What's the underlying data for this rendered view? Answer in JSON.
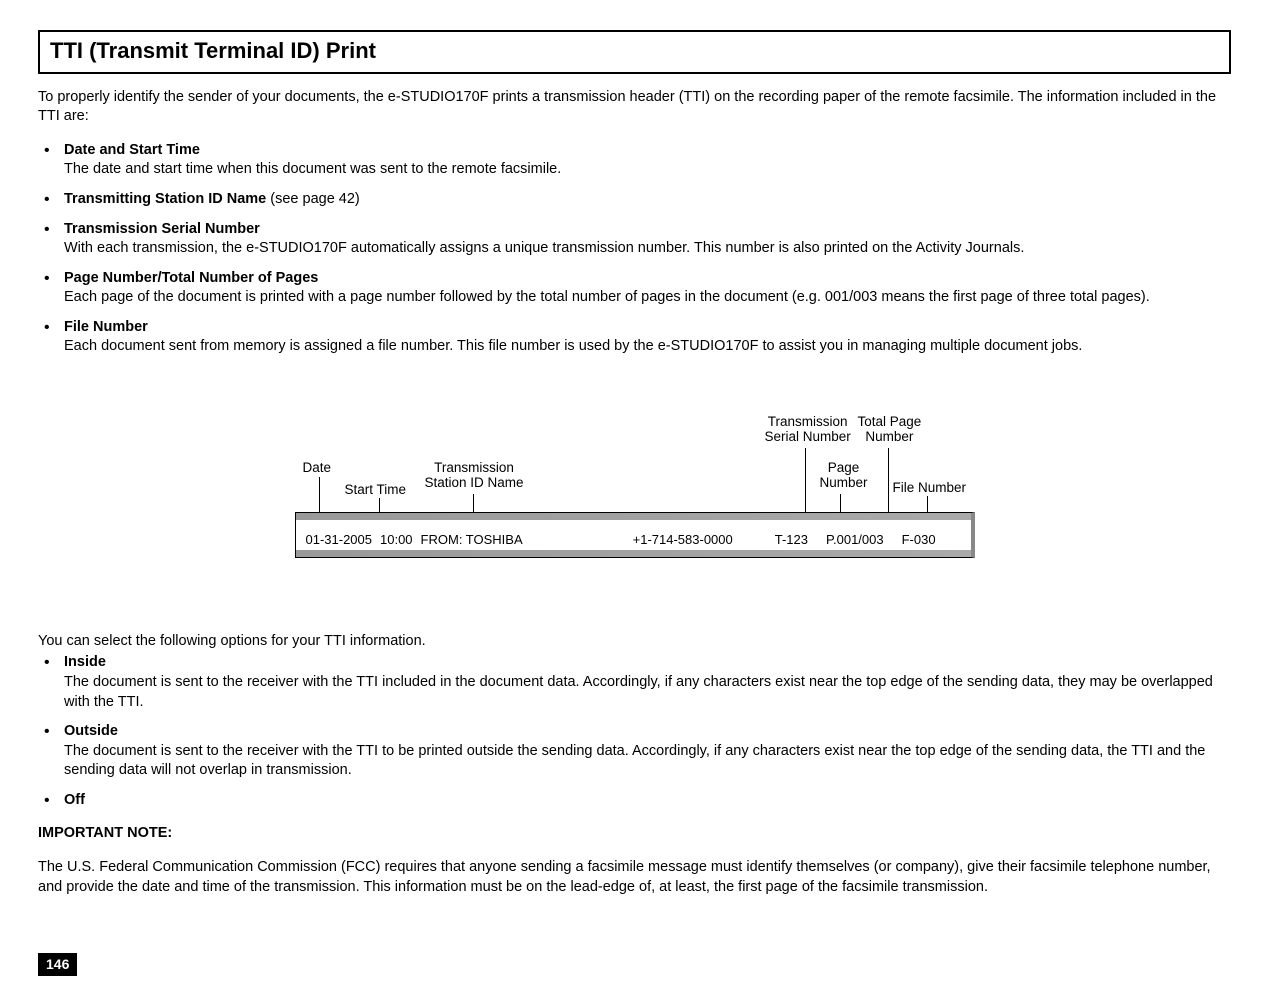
{
  "title": "TTI (Transmit Terminal ID) Print",
  "intro": "To properly identify the sender of your documents, the e-STUDIO170F prints a transmission header (TTI) on the recording paper of the remote facsimile. The information included in the TTI are:",
  "items": [
    {
      "head": "Date and Start Time",
      "ref": "",
      "desc": "The date and start time when this document was sent to the remote facsimile."
    },
    {
      "head": "Transmitting Station ID Name",
      "ref": " (see page 42)",
      "desc": ""
    },
    {
      "head": "Transmission Serial Number",
      "ref": "",
      "desc": "With each transmission, the e-STUDIO170F automatically assigns a unique transmission number. This number is also printed on the Activity Journals."
    },
    {
      "head": "Page Number/Total Number of Pages",
      "ref": "",
      "desc": "Each page of the document is printed with a page number followed by the total number of pages in the document (e.g. 001/003 means the first page of three total pages)."
    },
    {
      "head": "File Number",
      "ref": "",
      "desc": "Each document sent from memory is assigned a file number. This file number is used by the e-STUDIO170F to assist you in managing multiple document jobs."
    }
  ],
  "diagram": {
    "labels": {
      "date": "Date",
      "start_time": "Start Time",
      "station_id": "Transmission\nStation ID Name",
      "tx_serial": "Transmission\nSerial Number",
      "page_num": "Page\nNumber",
      "total_page": "Total Page\nNumber",
      "file_num": "File Number"
    },
    "sample": {
      "date": "01-31-2005",
      "time": "10:00",
      "from": "FROM:  TOSHIBA",
      "phone": "+1-714-583-0000",
      "serial": "T-123",
      "page": "P.001/003",
      "file": "F-030"
    }
  },
  "options_intro": "You can select the following options for your TTI information.",
  "options": [
    {
      "head": "Inside",
      "desc": "The document is sent to the receiver with the TTI included in the document data. Accordingly, if any characters exist near the top edge of the sending data, they may be overlapped with the TTI."
    },
    {
      "head": "Outside",
      "desc": "The document is sent to the receiver with the TTI to be printed outside the sending data. Accordingly, if any characters exist near the top edge of the sending data, the TTI and the sending data will not overlap in transmission."
    },
    {
      "head": "Off",
      "desc": ""
    }
  ],
  "note_head": "IMPORTANT NOTE:",
  "note_body": "The U.S. Federal Communication Commission (FCC) requires that anyone sending a facsimile message must identify themselves (or company), give their facsimile telephone number, and provide the date and time of the transmission. This information must be on the lead-edge of, at least, the first page of the facsimile transmission.",
  "page_number": "146"
}
